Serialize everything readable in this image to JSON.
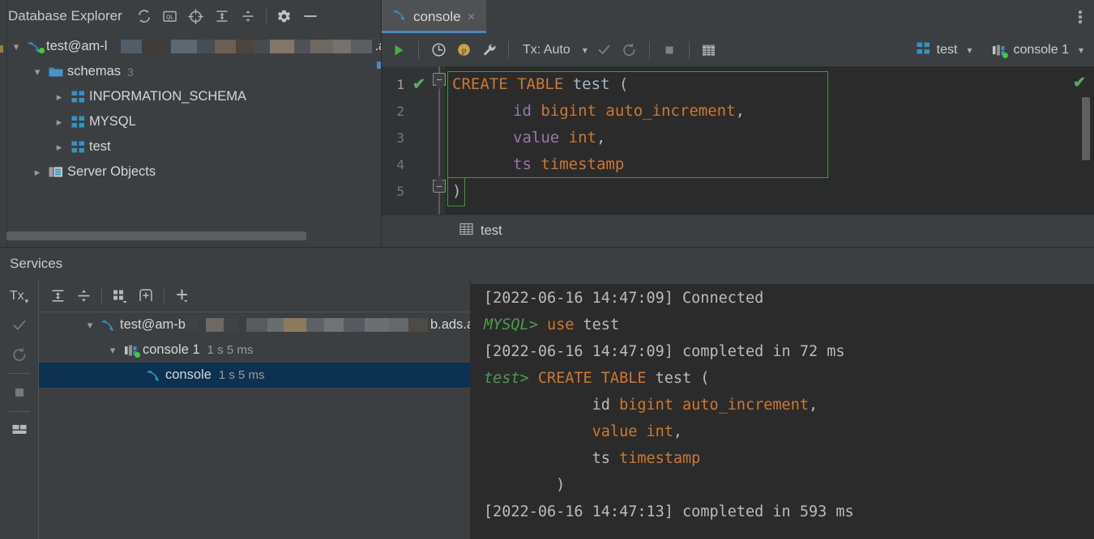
{
  "theme": {
    "bg_panel": "#3c3f41",
    "bg_editor": "#2b2b2b",
    "accent_blue": "#4a88c7",
    "keyword_orange": "#cc7832",
    "identifier_gray": "#a9b7c6",
    "column_purple": "#9876aa",
    "prompt_green": "#4e9a51",
    "success_green": "#59a869",
    "selection_navy": "#0d3150"
  },
  "database_explorer": {
    "title": "Database Explorer",
    "toolbar": [
      {
        "name": "refresh-icon",
        "title": "Refresh"
      },
      {
        "name": "query-console-icon",
        "title": "QL"
      },
      {
        "name": "scroll-from-source-icon",
        "title": "Scroll from Source"
      },
      {
        "name": "expand-all-icon",
        "title": "Expand All"
      },
      {
        "name": "collapse-all-icon",
        "title": "Collapse All"
      },
      {
        "name": "settings-gear-icon",
        "title": "Settings"
      },
      {
        "name": "minimize-icon",
        "title": "Hide"
      }
    ],
    "tree": [
      {
        "label": "test@am-l",
        "suffix": ".ads.aliy",
        "icon": "mysql-dolphin-icon",
        "expanded": true,
        "indent": 0,
        "redacted": true,
        "status": "connected"
      },
      {
        "label": "schemas",
        "count": "3",
        "icon": "folder-icon",
        "expanded": true,
        "indent": 1
      },
      {
        "label": "INFORMATION_SCHEMA",
        "icon": "schema-icon",
        "expanded": false,
        "indent": 2
      },
      {
        "label": "MYSQL",
        "icon": "schema-icon",
        "expanded": false,
        "indent": 2
      },
      {
        "label": "test",
        "icon": "schema-icon",
        "expanded": false,
        "indent": 2
      },
      {
        "label": "Server Objects",
        "icon": "server-objects-icon",
        "expanded": false,
        "indent": 1
      }
    ]
  },
  "console_tab": {
    "label": "console",
    "icon": "mysql-dolphin-icon",
    "close": "×",
    "active": true,
    "kebab": "more-options"
  },
  "editor_toolbar": {
    "buttons": [
      {
        "name": "execute-run-icon",
        "title": "Execute"
      },
      {
        "name": "history-clock-icon",
        "title": "History"
      },
      {
        "name": "parameters-icon",
        "title": "Parameters"
      },
      {
        "name": "wrench-icon",
        "title": "Data Source Properties"
      }
    ],
    "tx_label": "Tx: Auto",
    "tx_chevron": "⌄",
    "commit": {
      "name": "commit-check-icon",
      "title": "Commit"
    },
    "rollback": {
      "name": "rollback-icon",
      "title": "Rollback"
    },
    "stop": {
      "name": "stop-icon",
      "title": "Stop"
    },
    "table_editor": {
      "name": "table-editor-icon",
      "title": "Open Table Editor"
    },
    "schema_selector": {
      "label": "test",
      "icon": "schema-icon",
      "chevron": "⌄"
    },
    "session_selector": {
      "label": "console 1",
      "icon": "session-icon",
      "chevron": "⌄"
    }
  },
  "editor": {
    "line_numbers": [
      "1",
      "2",
      "3",
      "4",
      "5"
    ],
    "inspection_ok": "✔",
    "gutter_check": "✔",
    "code": [
      {
        "indent": 0,
        "tokens": [
          {
            "t": "CREATE TABLE ",
            "c": "kw"
          },
          {
            "t": "test",
            "c": "id"
          },
          {
            "t": " (",
            "c": "punc"
          }
        ]
      },
      {
        "indent": 1,
        "tokens": [
          {
            "t": "id",
            "c": "col"
          },
          {
            "t": " ",
            "c": "punc"
          },
          {
            "t": "bigint auto_increment",
            "c": "kw"
          },
          {
            "t": ",",
            "c": "punc"
          }
        ]
      },
      {
        "indent": 1,
        "tokens": [
          {
            "t": "value",
            "c": "col"
          },
          {
            "t": " ",
            "c": "punc"
          },
          {
            "t": "int",
            "c": "kw"
          },
          {
            "t": ",",
            "c": "punc"
          }
        ]
      },
      {
        "indent": 1,
        "tokens": [
          {
            "t": "ts",
            "c": "col"
          },
          {
            "t": " ",
            "c": "punc"
          },
          {
            "t": "timestamp",
            "c": "kw"
          }
        ]
      },
      {
        "indent": 0,
        "tokens": [
          {
            "t": ")",
            "c": "punc"
          }
        ]
      }
    ]
  },
  "result_strip": {
    "tab_label": "test",
    "tab_icon": "table-grid-icon"
  },
  "services": {
    "title": "Services",
    "side_tools": [
      {
        "name": "tx-dropdown",
        "label": "Tx",
        "chevron": "▾"
      },
      {
        "name": "commit-check-icon",
        "label": ""
      },
      {
        "name": "rollback-icon",
        "label": ""
      },
      {
        "name": "stop-icon",
        "label": ""
      },
      {
        "name": "layout-icon",
        "label": ""
      }
    ],
    "toolbar": [
      {
        "name": "expand-all-icon",
        "title": "Expand All"
      },
      {
        "name": "collapse-all-icon",
        "title": "Collapse All"
      },
      {
        "name": "layout-grid-dropdown-icon",
        "title": "Layout"
      },
      {
        "name": "new-tab-icon",
        "title": "New Tab"
      },
      {
        "name": "add-dropdown-icon",
        "title": "Add"
      }
    ],
    "tree": [
      {
        "label": "test@am-b",
        "suffix": "b.ads.aliyuncs.co",
        "icon": "mysql-dolphin-icon",
        "expanded": true,
        "indent": 0,
        "redacted": true
      },
      {
        "label": "console 1",
        "time": "1 s 5 ms",
        "icon": "session-icon",
        "expanded": true,
        "indent": 1
      },
      {
        "label": "console",
        "time": "1 s 5 ms",
        "icon": "mysql-dolphin-icon",
        "indent": 2,
        "selected": true
      }
    ],
    "output": [
      {
        "tokens": [
          {
            "t": "[2022-06-16 14:47:09] Connected",
            "c": "otxt"
          }
        ]
      },
      {
        "tokens": [
          {
            "t": "MYSQL> ",
            "c": "prompt"
          },
          {
            "t": "use",
            "c": "okw"
          },
          {
            "t": " test",
            "c": "otxt"
          }
        ]
      },
      {
        "tokens": [
          {
            "t": "[2022-06-16 14:47:09] completed in 72 ms",
            "c": "otxt"
          }
        ]
      },
      {
        "tokens": [
          {
            "t": "test> ",
            "c": "prompt"
          },
          {
            "t": "CREATE TABLE",
            "c": "okw"
          },
          {
            "t": " test (",
            "c": "otxt"
          }
        ]
      },
      {
        "tokens": [
          {
            "t": "            id ",
            "c": "otxt"
          },
          {
            "t": "bigint auto_increment",
            "c": "okw"
          },
          {
            "t": ",",
            "c": "otxt"
          }
        ]
      },
      {
        "tokens": [
          {
            "t": "            ",
            "c": "otxt"
          },
          {
            "t": "value int",
            "c": "okw"
          },
          {
            "t": ",",
            "c": "otxt"
          }
        ]
      },
      {
        "tokens": [
          {
            "t": "            ts ",
            "c": "otxt"
          },
          {
            "t": "timestamp",
            "c": "okw"
          }
        ]
      },
      {
        "tokens": [
          {
            "t": "        )",
            "c": "otxt"
          }
        ]
      },
      {
        "tokens": [
          {
            "t": "[2022-06-16 14:47:13] completed in 593 ms",
            "c": "otxt"
          }
        ]
      }
    ]
  }
}
